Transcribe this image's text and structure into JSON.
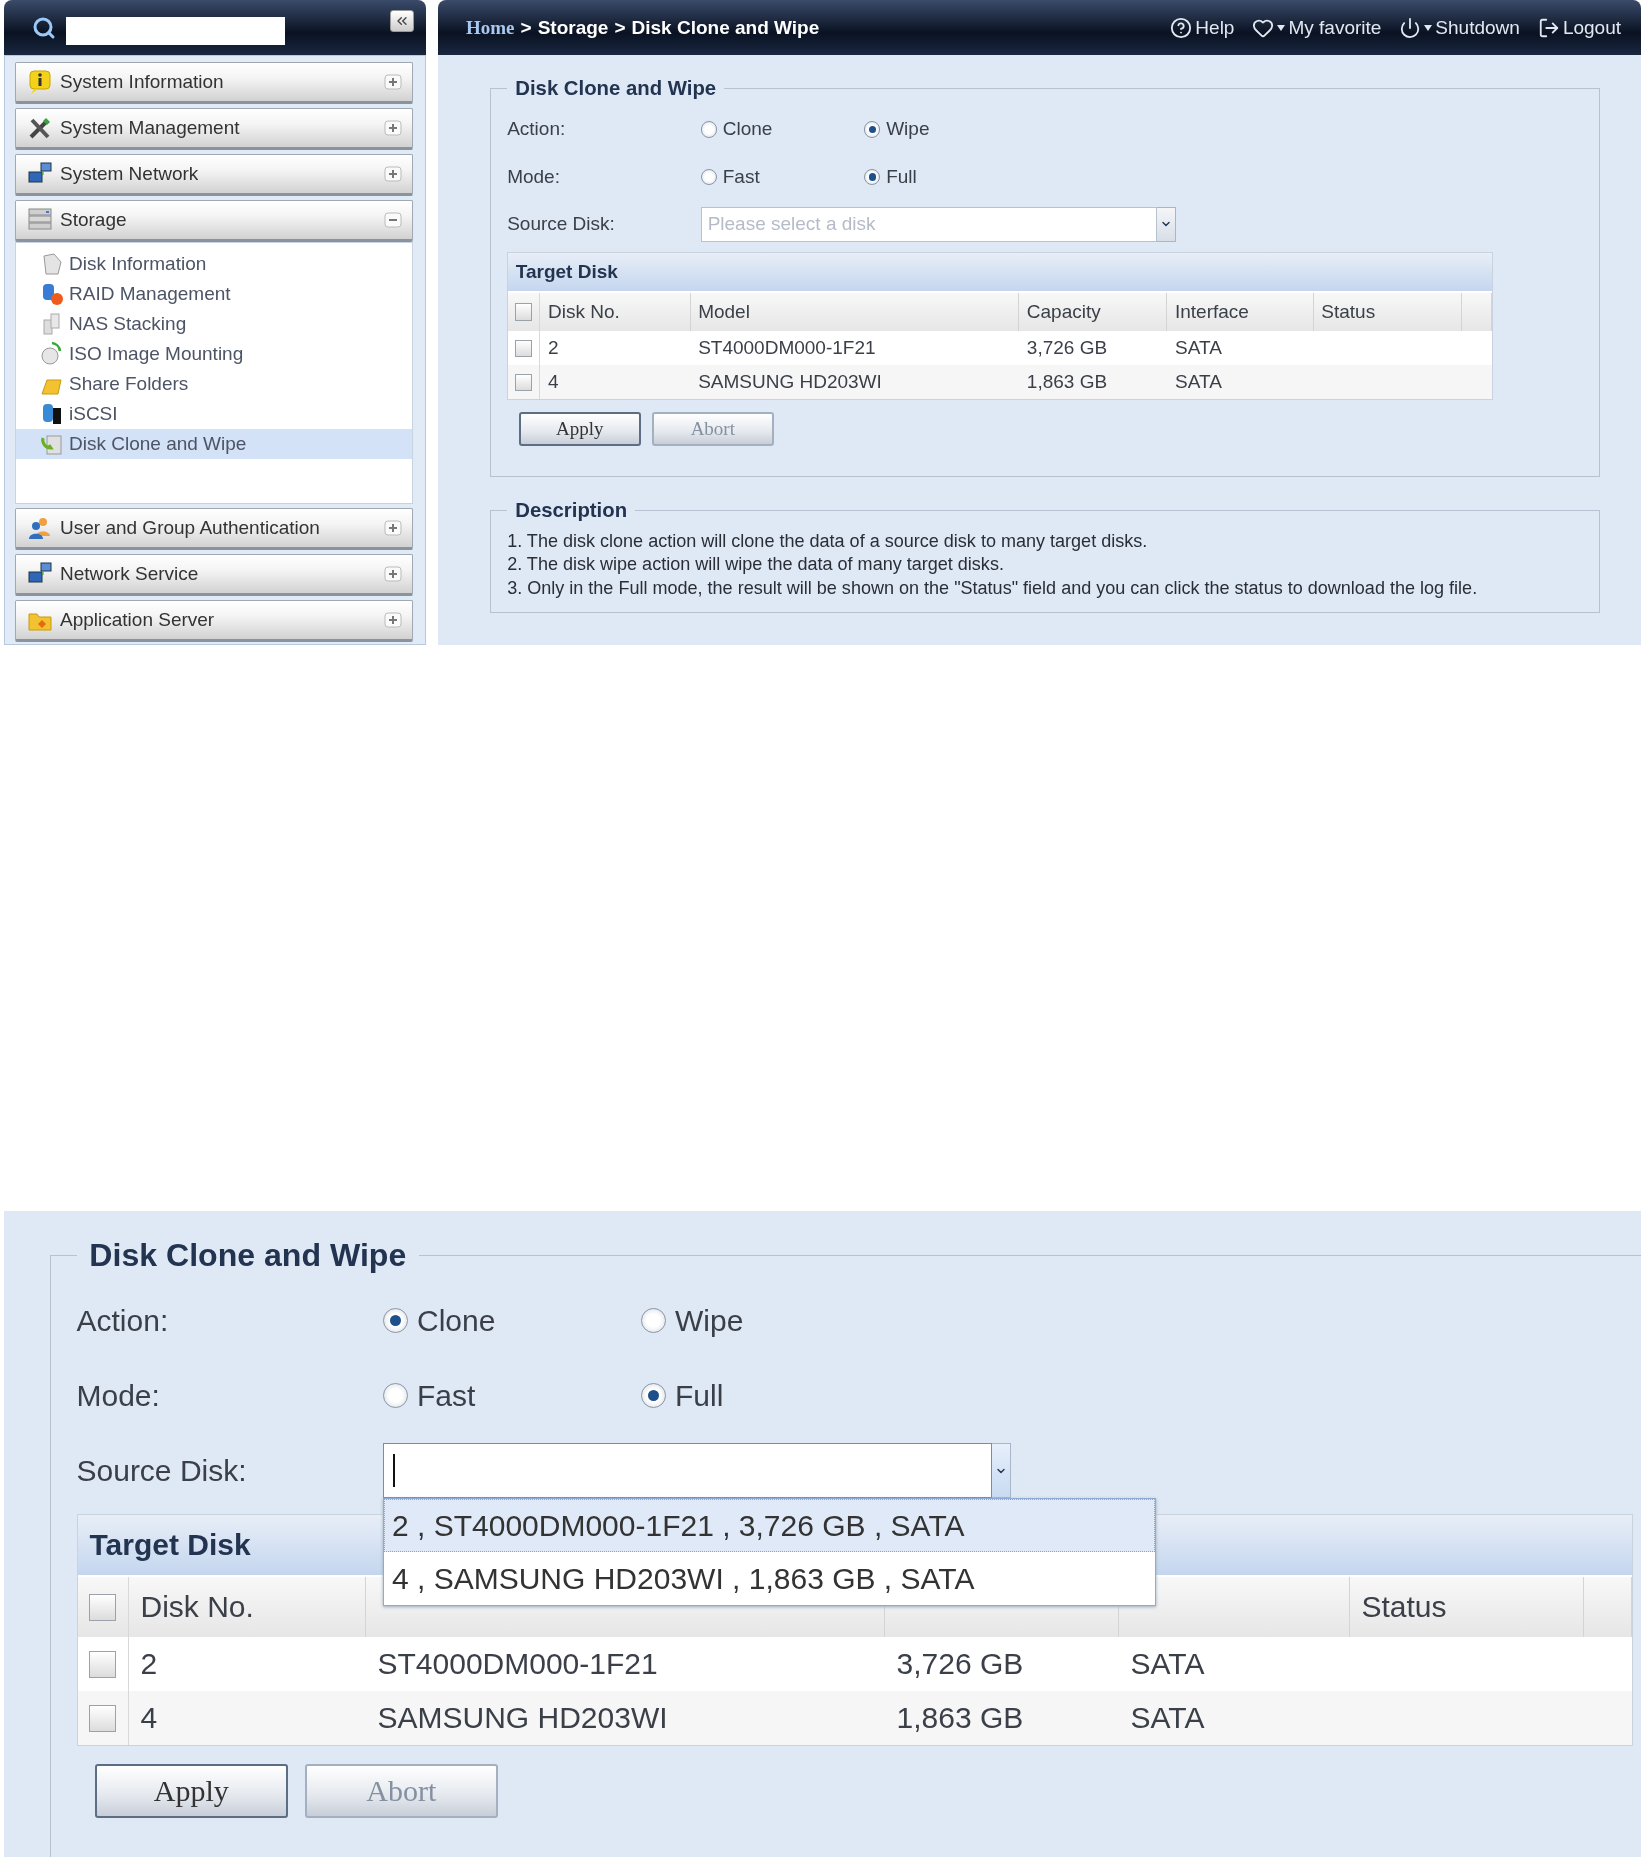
{
  "top_screenshot": {
    "sidebar": {
      "groups": [
        {
          "label": "System Information",
          "expanded": false
        },
        {
          "label": "System Management",
          "expanded": false
        },
        {
          "label": "System Network",
          "expanded": false
        },
        {
          "label": "Storage",
          "expanded": true,
          "children": [
            {
              "label": "Disk Information",
              "selected": false
            },
            {
              "label": "RAID Management",
              "selected": false
            },
            {
              "label": "NAS Stacking",
              "selected": false
            },
            {
              "label": "ISO Image Mounting",
              "selected": false
            },
            {
              "label": "Share Folders",
              "selected": false
            },
            {
              "label": "iSCSI",
              "selected": false
            },
            {
              "label": "Disk Clone and Wipe",
              "selected": true
            }
          ]
        },
        {
          "label": "User and Group Authentication",
          "expanded": false
        },
        {
          "label": "Network Service",
          "expanded": false
        },
        {
          "label": "Application Server",
          "expanded": false
        }
      ]
    },
    "header": {
      "breadcrumb": {
        "items": [
          "Home",
          "Storage",
          "Disk Clone and Wipe"
        ],
        "separator": ">"
      },
      "links": [
        "Help",
        "My favorite",
        "Shutdown",
        "Logout"
      ]
    },
    "form": {
      "title": "Disk Clone and Wipe",
      "action": {
        "label": "Action:",
        "options": [
          {
            "label": "Clone",
            "selected": false
          },
          {
            "label": "Wipe",
            "selected": true
          }
        ]
      },
      "mode": {
        "label": "Mode:",
        "options": [
          {
            "label": "Fast",
            "selected": false
          },
          {
            "label": "Full",
            "selected": true
          }
        ]
      },
      "source_disk": {
        "label": "Source Disk:",
        "placeholder": "Please select a disk",
        "focused": false,
        "open": false
      },
      "target_disk": {
        "title": "Target Disk",
        "all_checked": false,
        "columns": [
          {
            "kind": "text",
            "label": "Disk No."
          },
          {
            "kind": "text",
            "label": "Model"
          },
          {
            "kind": "text",
            "label": "Capacity"
          },
          {
            "kind": "text",
            "label": "Interface"
          },
          {
            "kind": "text",
            "label": "Status"
          }
        ],
        "rows": [
          {
            "checked": false,
            "cells": [
              "2",
              "ST4000DM000-1F21",
              "3,726 GB",
              "SATA"
            ]
          },
          {
            "checked": false,
            "cells": [
              "4",
              "SAMSUNG HD203WI",
              "1,863 GB",
              "SATA"
            ]
          }
        ]
      },
      "buttons": [
        {
          "label": "Apply",
          "disabled": false
        },
        {
          "label": "Abort",
          "disabled": true
        }
      ]
    },
    "description": {
      "title": "Description",
      "lines": [
        "1. The disk clone action will clone the data of a source disk to many target disks.",
        "2. The disk wipe action will wipe the data of many target disks.",
        "3. Only in the Full mode, the result will be shown on the \"Status\" field and you can click the status to download the log file."
      ]
    }
  },
  "bottom_screenshot": {
    "form": {
      "title": "Disk Clone and Wipe",
      "action": {
        "label": "Action:",
        "options": [
          {
            "label": "Clone",
            "selected": true
          },
          {
            "label": "Wipe",
            "selected": false
          }
        ]
      },
      "mode": {
        "label": "Mode:",
        "options": [
          {
            "label": "Fast",
            "selected": false
          },
          {
            "label": "Full",
            "selected": true
          }
        ]
      },
      "source_disk": {
        "label": "Source Disk:",
        "focused": true,
        "open": true,
        "options": [
          {
            "label": "2 , ST4000DM000-1F21 , 3,726 GB , SATA",
            "selected": true
          },
          {
            "label": "4 , SAMSUNG HD203WI , 1,863 GB , SATA",
            "selected": false
          }
        ]
      },
      "target_disk": {
        "title": "Target Disk",
        "all_checked": false,
        "columns": [
          {
            "kind": "text",
            "label": "Disk No."
          },
          {
            "kind": "covered"
          },
          {
            "kind": "covered"
          },
          {
            "kind": "covered"
          },
          {
            "kind": "text",
            "label": "Status"
          }
        ],
        "rows": [
          {
            "checked": false,
            "cells": [
              "2",
              "ST4000DM000-1F21",
              "3,726 GB",
              "SATA"
            ]
          },
          {
            "checked": false,
            "cells": [
              "4",
              "SAMSUNG HD203WI",
              "1,863 GB",
              "SATA"
            ]
          }
        ]
      },
      "buttons": [
        {
          "label": "Apply",
          "disabled": false
        },
        {
          "label": "Abort",
          "disabled": true
        }
      ]
    }
  }
}
